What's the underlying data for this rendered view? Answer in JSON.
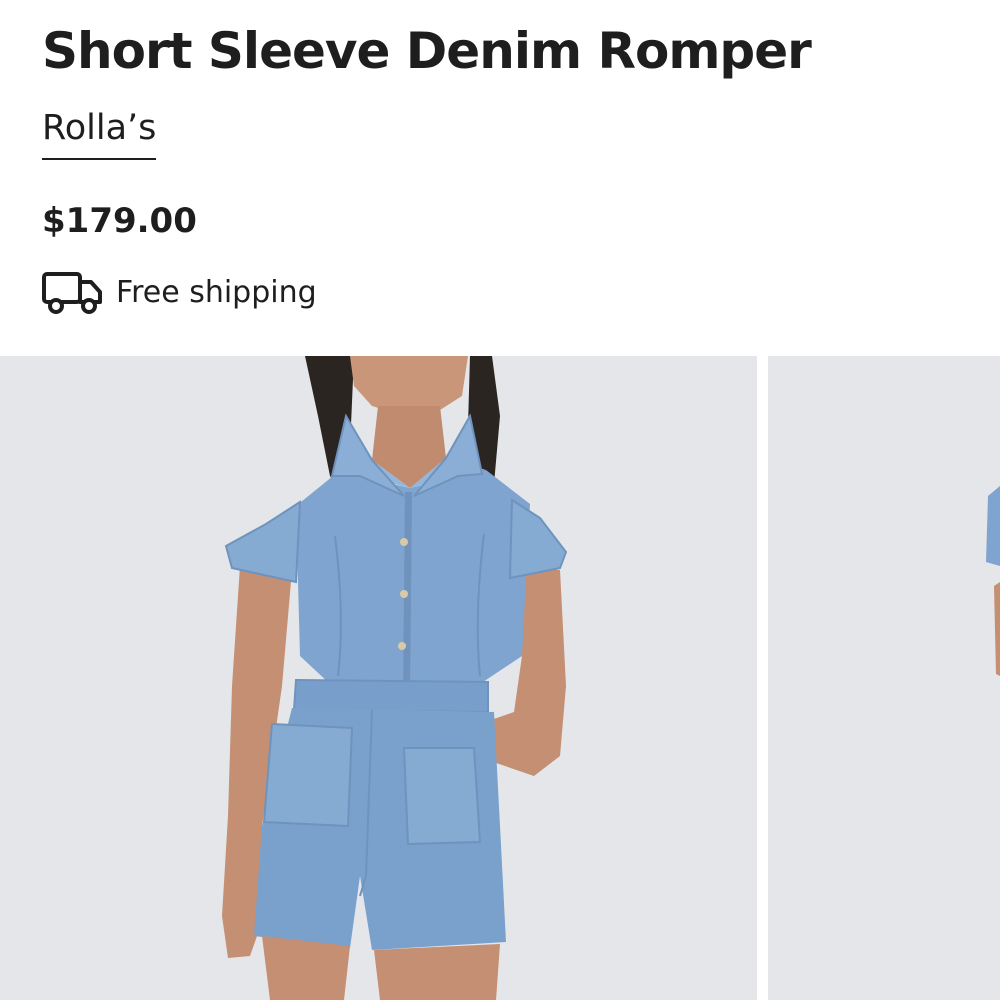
{
  "product": {
    "title": "Short Sleeve Denim Romper",
    "brand": "Rolla’s",
    "price": "$179.00",
    "shipping_label": "Free shipping",
    "shipping_icon": "truck-icon"
  },
  "gallery": {
    "images": [
      {
        "name": "model-front-photo",
        "content": "photo of model wearing denim romper"
      },
      {
        "name": "model-alt-photo",
        "content": "partial second product photo"
      }
    ]
  },
  "colors": {
    "text": "#1e1e1e",
    "photo_background": "#e4e6e9",
    "denim": "#7ea4cf"
  }
}
